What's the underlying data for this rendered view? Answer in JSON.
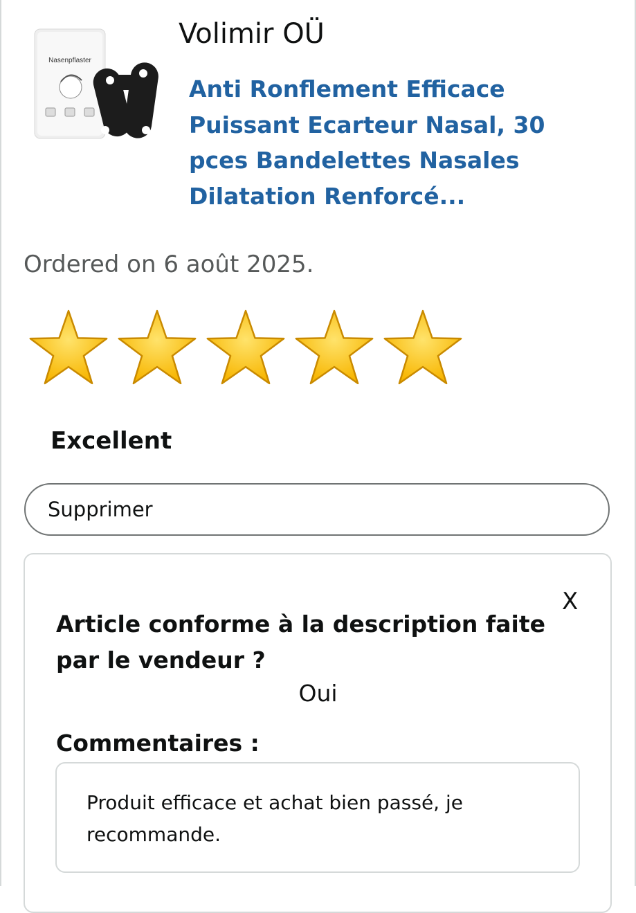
{
  "review": {
    "seller": "Volimir OÜ",
    "product_title": "Anti Ronflement Efficace Puissant Ecarteur Nasal, 30 pces Bandelettes Nasales Dilatation Renforcé...",
    "product_image_label": "Nasenpflaster",
    "ordered": "Ordered on 6 août 2025.",
    "rating": {
      "value": 5,
      "max": 5,
      "label": "Excellent"
    },
    "delete_button": "Supprimer"
  },
  "feedback": {
    "close": "X",
    "question": "Article conforme à la description faite par le vendeur ?",
    "answer": "Oui",
    "comments_label": "Commentaires :",
    "comment": "Produit efficace et achat bien passé, je recommande."
  },
  "colors": {
    "link": "#2162a1",
    "star_fill": "#f7b500",
    "star_stroke": "#c98a00",
    "muted_text": "#565959"
  }
}
